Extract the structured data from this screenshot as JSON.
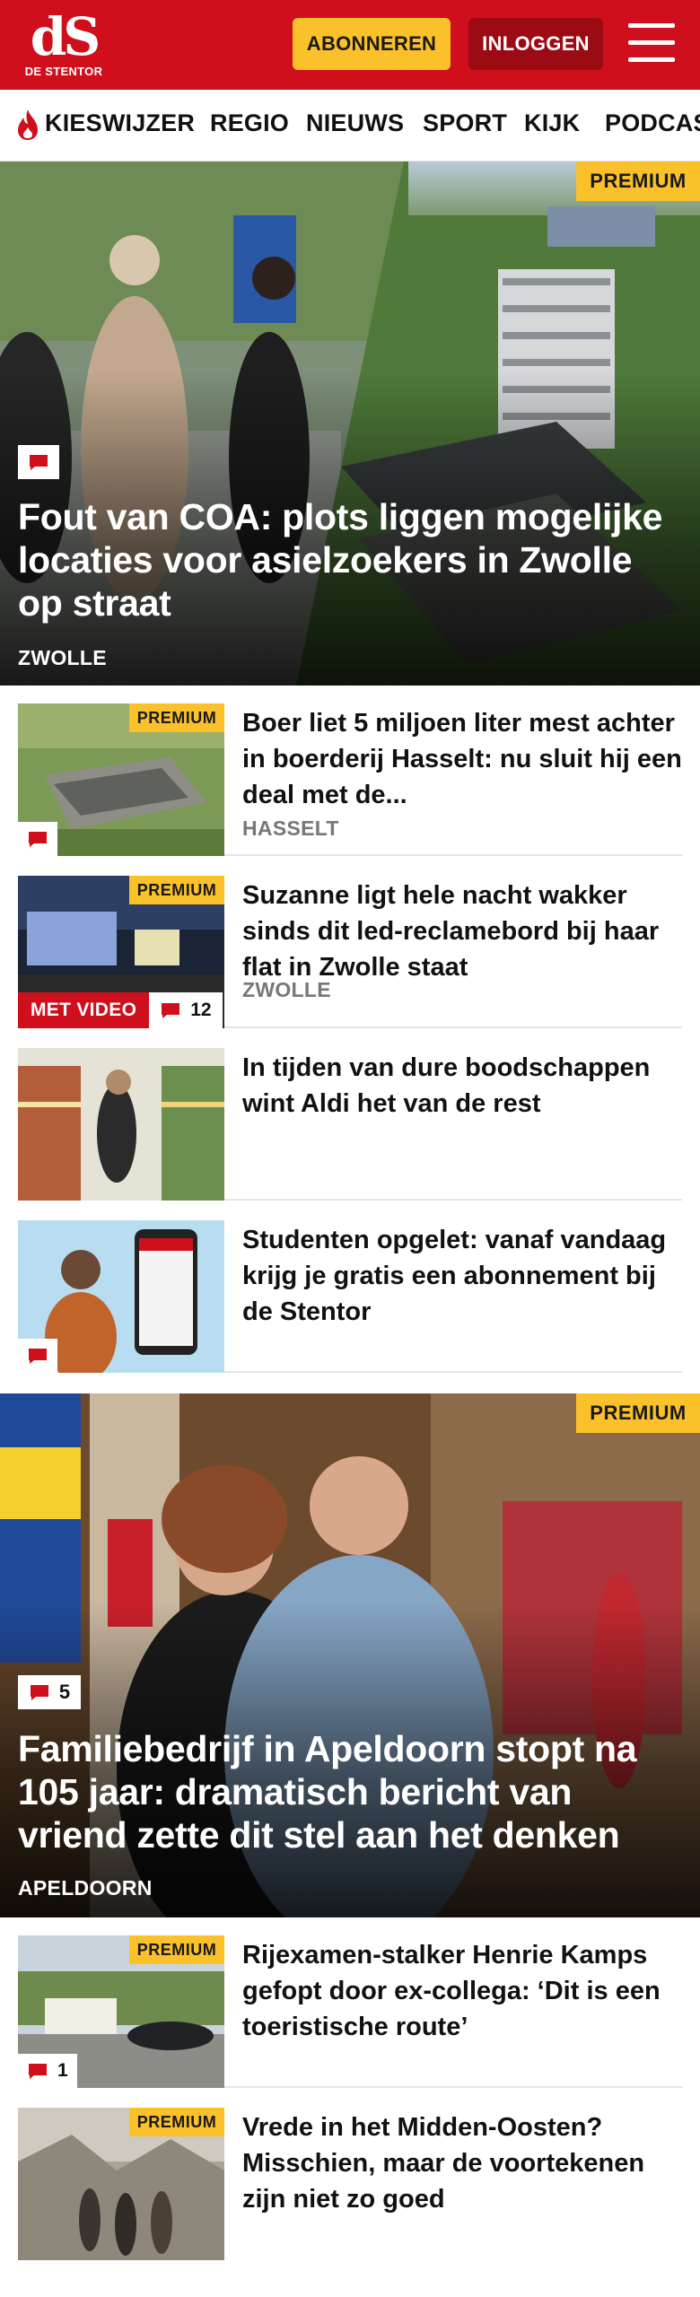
{
  "header": {
    "logo_mark": "dS",
    "logo_text": "DE STENTOR",
    "subscribe_label": "ABONNEREN",
    "login_label": "INLOGGEN",
    "brand_red": "#d00f1d",
    "premium_yellow": "#fbc12a"
  },
  "nav": {
    "items": [
      "KIESWIJZER",
      "REGIO",
      "NIEUWS",
      "SPORT",
      "KIJK",
      "PODCAS"
    ]
  },
  "articles": {
    "hero1": {
      "premium": "PREMIUM",
      "title": "Fout van COA: plots liggen mogelijke locaties voor asielzoekers in Zwolle op straat",
      "tag": "ZWOLLE",
      "comment_count": ""
    },
    "list1": [
      {
        "premium": "PREMIUM",
        "title": "Boer liet 5 miljoen liter mest achter in boerderij Hasselt: nu sluit hij een deal met de...",
        "tag": "HASSELT",
        "comment_count": ""
      },
      {
        "premium": "PREMIUM",
        "title": "Suzanne ligt hele nacht wakker sinds dit led-reclamebord bij haar flat in Zwolle staat",
        "tag": "ZWOLLE",
        "video_label": "MET VIDEO",
        "comment_count": "12"
      },
      {
        "title": "In tijden van dure boodschappen wint Aldi het van de rest"
      },
      {
        "title": "Studenten opgelet: vanaf vandaag krijg je gratis een abonnement bij de Stentor",
        "comment_count": ""
      }
    ],
    "hero2": {
      "premium": "PREMIUM",
      "title": "Familiebedrijf in Apeldoorn stopt na 105 jaar: dramatisch bericht van vriend zette dit stel aan het denken",
      "tag": "APELDOORN",
      "comment_count": "5"
    },
    "list2": [
      {
        "premium": "PREMIUM",
        "title": "Rijexamen-stalker Henrie Kamps gefopt door ex-collega: ‘Dit is een toeristische route’",
        "comment_count": "1"
      },
      {
        "premium": "PREMIUM",
        "title": "Vrede in het Midden-Oosten? Misschien, maar de voortekenen zijn niet zo goed"
      }
    ]
  }
}
